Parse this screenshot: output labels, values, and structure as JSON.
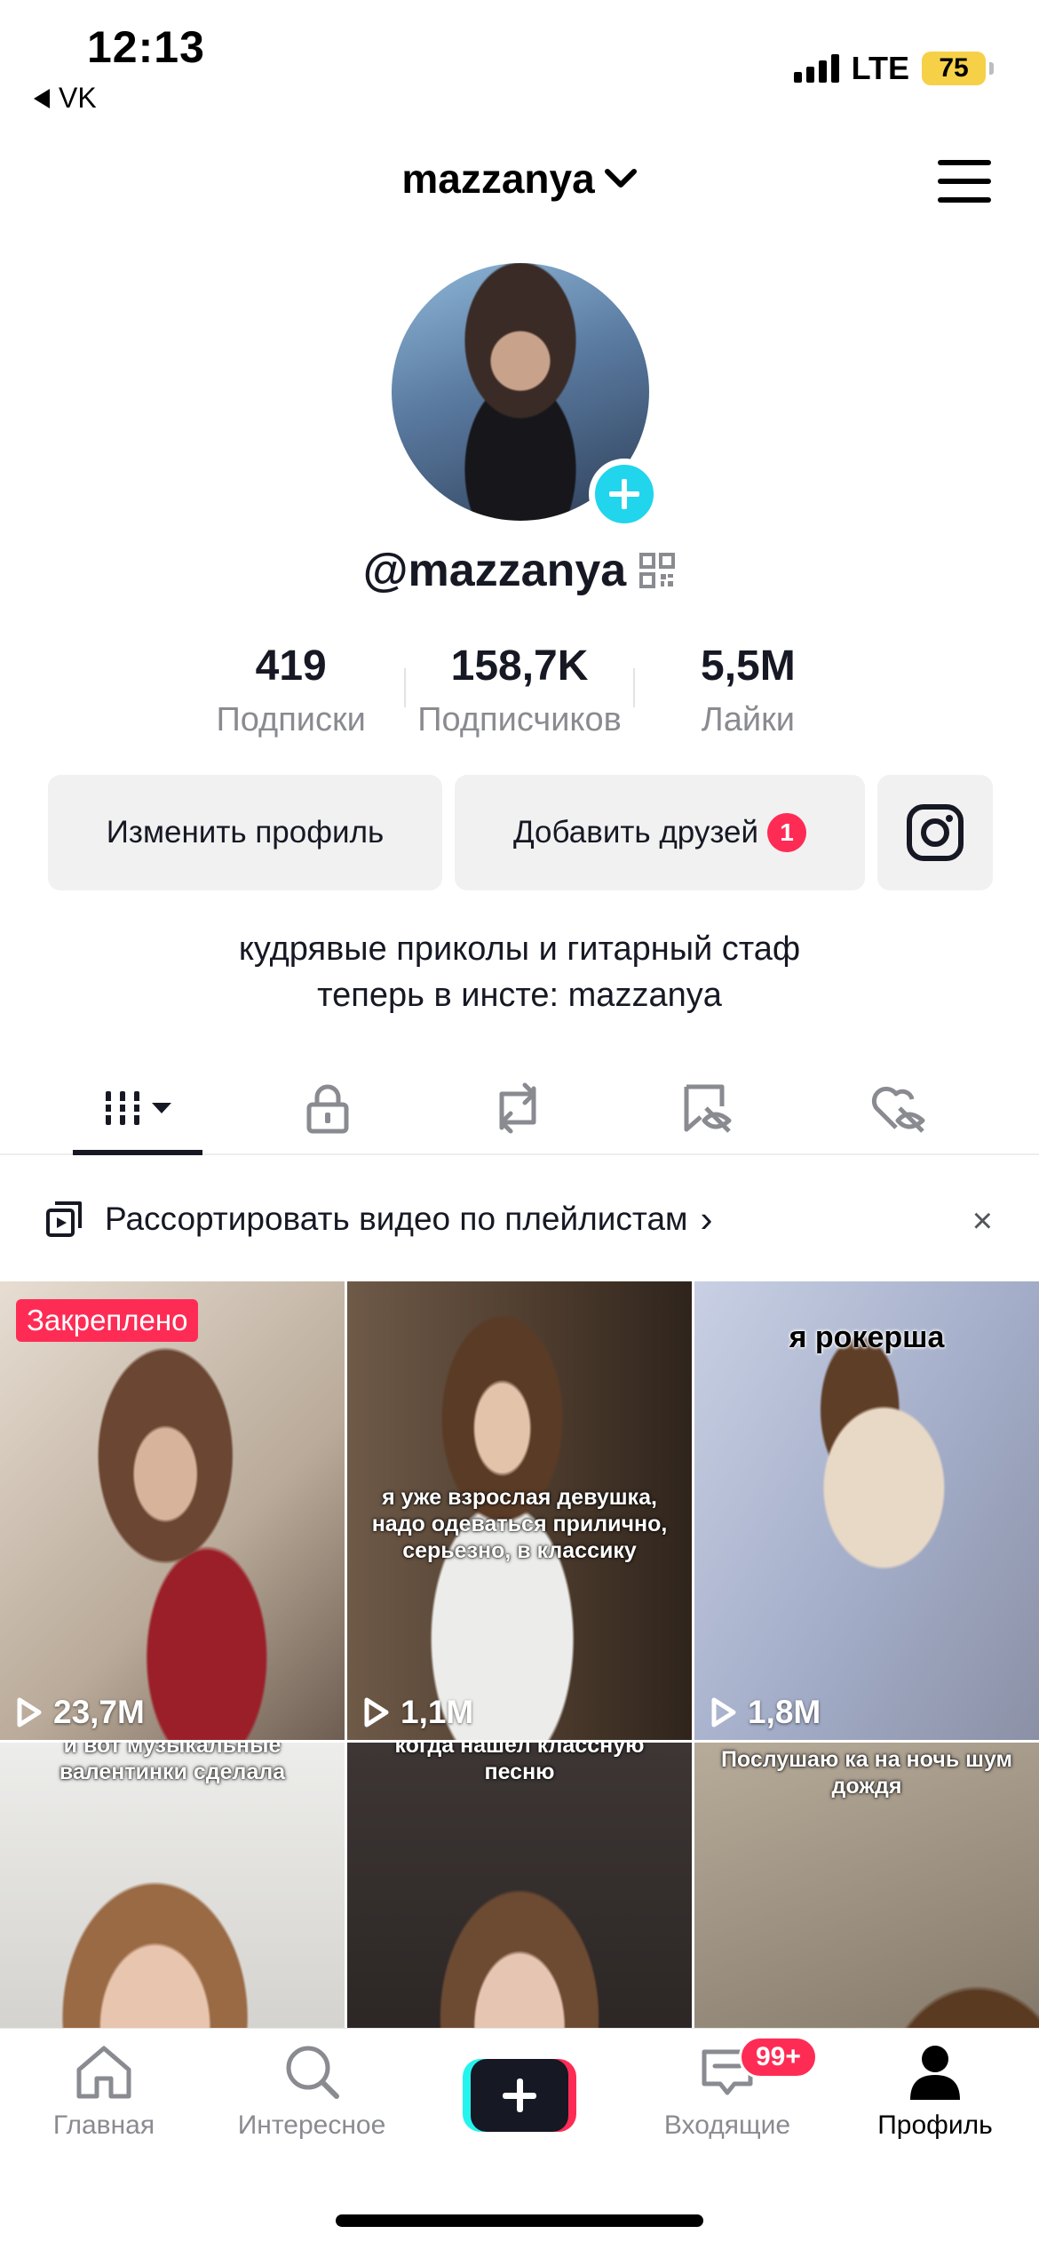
{
  "status_bar": {
    "time": "12:13",
    "back_app": "VK",
    "network": "LTE",
    "battery": "75"
  },
  "header": {
    "username": "mazzanya"
  },
  "profile": {
    "handle": "@mazzanya",
    "stats": [
      {
        "value": "419",
        "label": "Подписки"
      },
      {
        "value": "158,7K",
        "label": "Подписчиков"
      },
      {
        "value": "5,5M",
        "label": "Лайки"
      }
    ],
    "edit_button": "Изменить профиль",
    "add_friends_button": "Добавить друзей",
    "add_friends_badge": "1",
    "bio_line1": "кудрявые приколы и гитарный стаф",
    "bio_line2": "теперь в инсте: mazzanya"
  },
  "playlist_banner": {
    "text": "Рассортировать видео по плейлистам",
    "chevron": "›",
    "close": "×"
  },
  "videos": [
    {
      "views": "23,7M",
      "pinned": "Закреплено",
      "caption": ""
    },
    {
      "views": "1,1M",
      "caption": "я уже взрослая девушка, надо одеваться прилично, серьезно, в классику"
    },
    {
      "views": "1,8M",
      "caption": "я рокерша"
    },
    {
      "views": "",
      "caption": "и вот музыкальные валентинки сделала"
    },
    {
      "views": "",
      "caption": "когда нашел классную песню"
    },
    {
      "views": "",
      "caption": "Послушаю ка на ночь шум дождя"
    }
  ],
  "bottom_nav": {
    "home": "Главная",
    "discover": "Интересное",
    "inbox": "Входящие",
    "inbox_badge": "99+",
    "profile": "Профиль"
  },
  "colors": {
    "accent_red": "#fe2c55",
    "accent_cyan": "#25f4ee",
    "text_primary": "#161823",
    "text_secondary": "#8a8b91"
  }
}
